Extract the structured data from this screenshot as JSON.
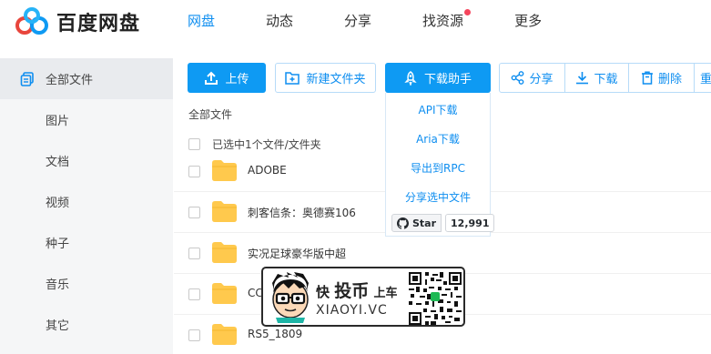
{
  "app": {
    "title": "百度网盘"
  },
  "nav": [
    {
      "label": "网盘",
      "active": true
    },
    {
      "label": "动态",
      "active": false
    },
    {
      "label": "分享",
      "active": false
    },
    {
      "label": "找资源",
      "active": false,
      "badge_dot": true
    },
    {
      "label": "更多",
      "active": false
    }
  ],
  "sidebar": {
    "items": [
      {
        "label": "全部文件",
        "active": true,
        "icon": "files-icon"
      },
      {
        "label": "图片"
      },
      {
        "label": "文档"
      },
      {
        "label": "视频"
      },
      {
        "label": "种子"
      },
      {
        "label": "音乐"
      },
      {
        "label": "其它"
      }
    ]
  },
  "toolbar": {
    "upload_label": "上传",
    "new_folder_label": "新建文件夹",
    "download_helper_label": "下载助手",
    "share_label": "分享",
    "download_label": "下载",
    "delete_label": "删除",
    "more_label": "重"
  },
  "dropdown": {
    "items": [
      "API下载",
      "Aria下载",
      "导出到RPC",
      "分享选中文件"
    ],
    "github": {
      "star_label": "Star",
      "count": "12,991"
    }
  },
  "breadcrumb": "全部文件",
  "selection_text": "已选中1个文件/文件夹",
  "files": [
    {
      "name": "ADOBE"
    },
    {
      "name": "刺客信条：奥德赛106"
    },
    {
      "name": "实况足球豪华版中超"
    },
    {
      "name": "CC"
    },
    {
      "name": "RS5_1809"
    }
  ],
  "watermark": {
    "line1_a": "快",
    "line1_b": "投币",
    "line1_c": "上车",
    "line2": "XIAOYI.VC"
  },
  "colors": {
    "accent": "#0e9af3",
    "link": "#0e8ef0",
    "folder": "#ffc94d",
    "badge": "#f5455c"
  }
}
